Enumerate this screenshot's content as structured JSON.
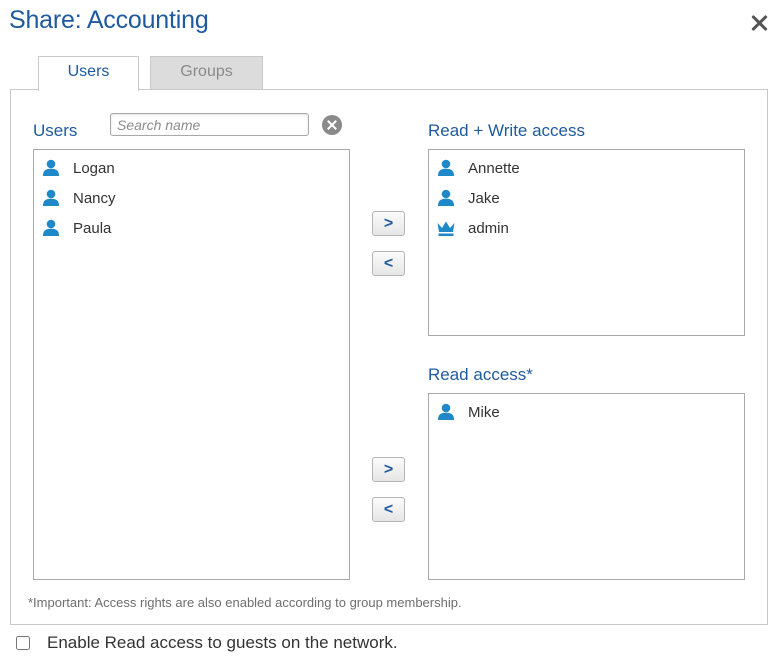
{
  "dialog": {
    "title": "Share: Accounting"
  },
  "tabs": [
    {
      "label": "Users",
      "active": true
    },
    {
      "label": "Groups",
      "active": false
    }
  ],
  "users_column": {
    "label": "Users",
    "search_placeholder": "Search name",
    "items": [
      {
        "name": "Logan",
        "icon": "user-icon"
      },
      {
        "name": "Nancy",
        "icon": "user-icon"
      },
      {
        "name": "Paula",
        "icon": "user-icon"
      }
    ]
  },
  "read_write": {
    "label": "Read + Write access",
    "items": [
      {
        "name": "Annette",
        "icon": "user-icon"
      },
      {
        "name": "Jake",
        "icon": "user-icon"
      },
      {
        "name": "admin",
        "icon": "crown-icon"
      }
    ]
  },
  "read_only": {
    "label": "Read access*",
    "items": [
      {
        "name": "Mike",
        "icon": "user-icon"
      }
    ]
  },
  "buttons": {
    "add_label": ">",
    "remove_label": "<"
  },
  "footnote": "*Important: Access rights are also enabled according to group membership.",
  "guest_option": {
    "label": "Enable Read access to guests on the network.",
    "checked": false
  },
  "colors": {
    "accent": "#1f5a9e",
    "icon": "#1e88c8"
  }
}
